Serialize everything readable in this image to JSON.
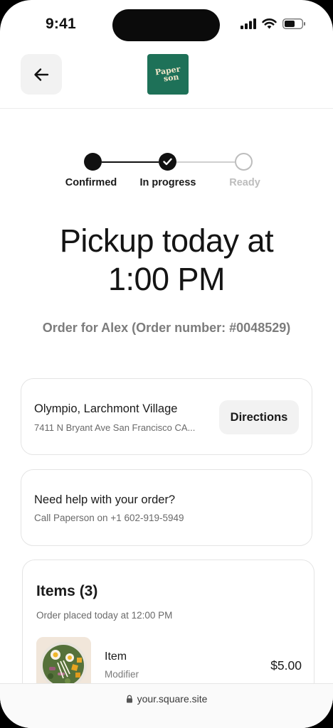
{
  "status_bar": {
    "time": "9:41"
  },
  "header": {
    "logo_line1": "Paper",
    "logo_line2": "son"
  },
  "progress": {
    "steps": [
      {
        "label": "Confirmed",
        "state": "done"
      },
      {
        "label": "In progress",
        "state": "current"
      },
      {
        "label": "Ready",
        "state": "pending"
      }
    ]
  },
  "pickup": {
    "title_line1": "Pickup today at",
    "title_line2": "1:00 PM",
    "order_info": "Order for Alex (Order number: #0048529)"
  },
  "location": {
    "name": "Olympio, Larchmont Village",
    "address": "7411 N Bryant Ave San Francisco CA...",
    "directions_label": "Directions"
  },
  "help": {
    "title": "Need help with your order?",
    "subtitle": "Call Paperson on +1 602-919-5949"
  },
  "items": {
    "title": "Items (3)",
    "placed": "Order placed today at 12:00 PM",
    "list": [
      {
        "name": "Item",
        "modifier": "Modifier",
        "price": "$5.00"
      }
    ]
  },
  "browser": {
    "url": "your.square.site"
  },
  "colors": {
    "brand_green": "#1e7158",
    "accent_dark": "#111111",
    "muted": "#7c7c7c"
  }
}
